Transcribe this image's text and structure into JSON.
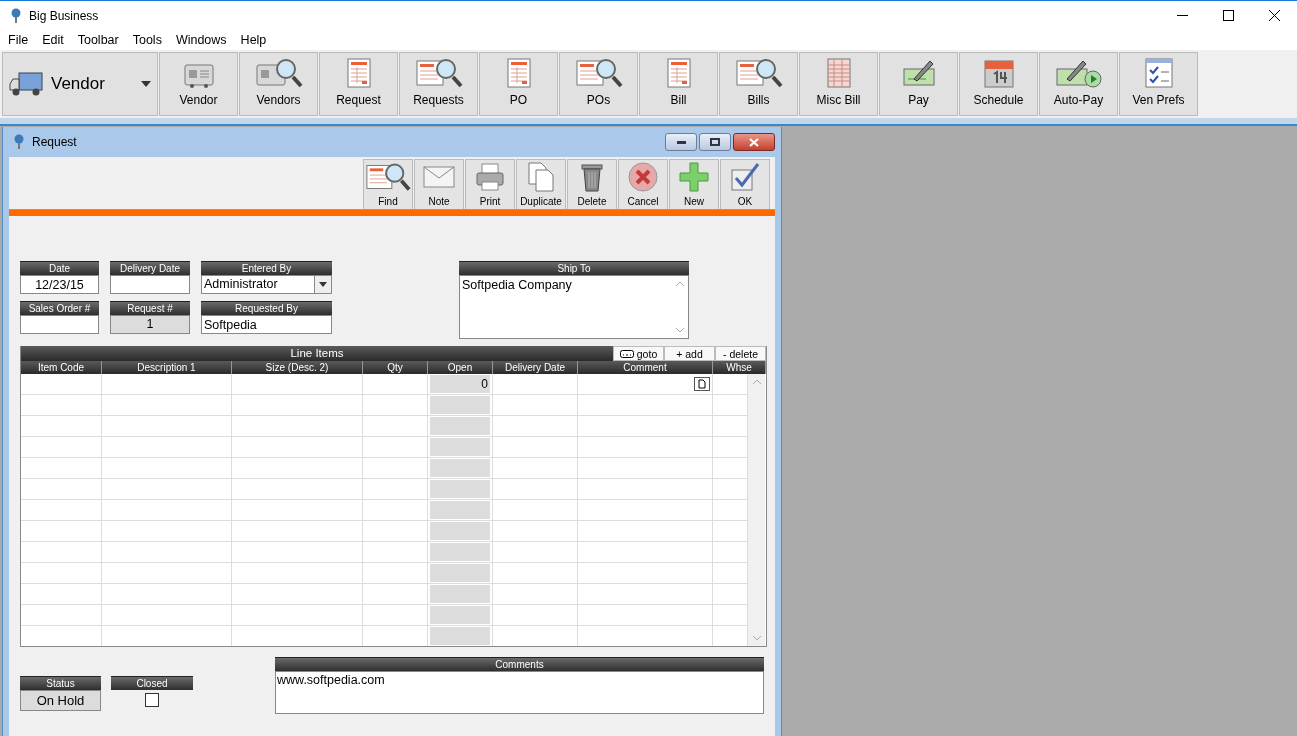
{
  "window": {
    "title": "Big Business"
  },
  "menu": [
    "File",
    "Edit",
    "Toolbar",
    "Tools",
    "Windows",
    "Help"
  ],
  "module_selector": {
    "label": "Vendor"
  },
  "toolbar": [
    {
      "label": "Vendor",
      "kind": "card"
    },
    {
      "label": "Vendors",
      "kind": "card-search"
    },
    {
      "label": "Request",
      "kind": "sheet"
    },
    {
      "label": "Requests",
      "kind": "sheet-search"
    },
    {
      "label": "PO",
      "kind": "sheet"
    },
    {
      "label": "POs",
      "kind": "sheet-search"
    },
    {
      "label": "Bill",
      "kind": "sheet"
    },
    {
      "label": "Bills",
      "kind": "sheet-search"
    },
    {
      "label": "Misc Bill",
      "kind": "grid"
    },
    {
      "label": "Pay",
      "kind": "check"
    },
    {
      "label": "Schedule",
      "kind": "calendar"
    },
    {
      "label": "Auto-Pay",
      "kind": "check-play"
    },
    {
      "label": "Ven Prefs",
      "kind": "checklist"
    }
  ],
  "child_window": {
    "title": "Request",
    "actions": [
      {
        "label": "Find",
        "kind": "find"
      },
      {
        "label": "Note",
        "kind": "note"
      },
      {
        "label": "Print",
        "kind": "print"
      },
      {
        "label": "Duplicate",
        "kind": "duplicate"
      },
      {
        "label": "Delete",
        "kind": "delete"
      },
      {
        "label": "Cancel",
        "kind": "cancel"
      },
      {
        "label": "New",
        "kind": "new"
      },
      {
        "label": "OK",
        "kind": "ok"
      }
    ],
    "fields": {
      "date": {
        "label": "Date",
        "value": "12/23/15"
      },
      "delivery_date": {
        "label": "Delivery Date"
      },
      "entered_by": {
        "label": "Entered By",
        "value": "Administrator"
      },
      "sales_order": {
        "label": "Sales Order #"
      },
      "request_no": {
        "label": "Request #",
        "value": "1"
      },
      "requested_by": {
        "label": "Requested By",
        "value": "Softpedia"
      },
      "ship_to": {
        "label": "Ship To",
        "value": "Softpedia Company"
      }
    },
    "line_items": {
      "title": "Line Items",
      "buttons": [
        "goto",
        "+ add",
        "- delete"
      ],
      "columns": [
        "Item Code",
        "Description 1",
        "Size (Desc. 2)",
        "Qty",
        "Open",
        "Delivery Date",
        "Comment",
        "Whse"
      ],
      "rows": [
        {
          "open": "0",
          "note": true
        }
      ]
    },
    "status": {
      "label": "Status",
      "value": "On Hold"
    },
    "closed": {
      "label": "Closed",
      "checked": false
    },
    "comments": {
      "label": "Comments",
      "value": "www.softpedia.com"
    }
  }
}
